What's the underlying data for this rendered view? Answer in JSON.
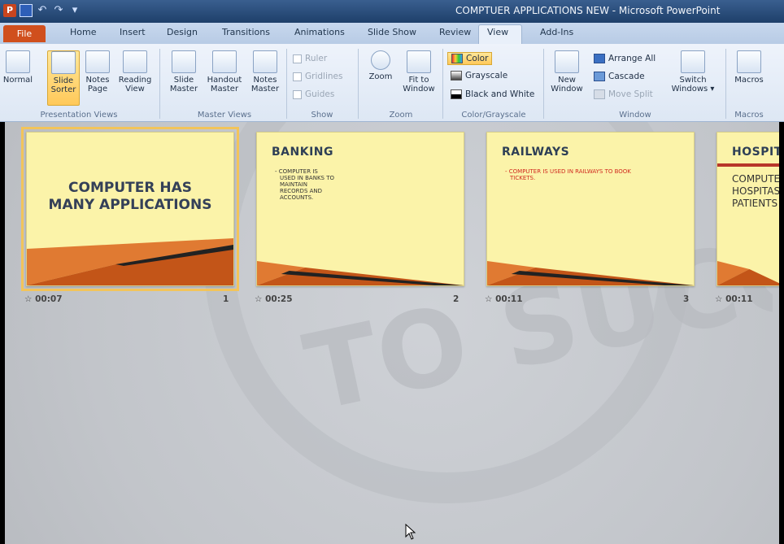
{
  "window": {
    "title": "COMPTUER APPLICATIONS NEW - Microsoft PowerPoint",
    "app_icon": "P"
  },
  "tabs": [
    "File",
    "Home",
    "Insert",
    "Design",
    "Transitions",
    "Animations",
    "Slide Show",
    "Review",
    "View",
    "Add-Ins"
  ],
  "active_tab": "View",
  "ribbon": {
    "presentation_views": {
      "normal": "Normal",
      "slide_sorter": [
        "Slide",
        "Sorter"
      ],
      "notes_page": [
        "Notes",
        "Page"
      ],
      "reading_view": [
        "Reading",
        "View"
      ],
      "label": "Presentation Views"
    },
    "master_views": {
      "slide_master": [
        "Slide",
        "Master"
      ],
      "handout_master": [
        "Handout",
        "Master"
      ],
      "notes_master": [
        "Notes",
        "Master"
      ],
      "label": "Master Views"
    },
    "show": {
      "ruler": "Ruler",
      "gridlines": "Gridlines",
      "guides": "Guides",
      "label": "Show"
    },
    "zoom": {
      "zoom": "Zoom",
      "fit_to_window": [
        "Fit to",
        "Window"
      ],
      "label": "Zoom"
    },
    "color_grayscale": {
      "color": "Color",
      "grayscale": "Grayscale",
      "black_white": "Black and White",
      "label": "Color/Grayscale"
    },
    "window": {
      "new_window": [
        "New",
        "Window"
      ],
      "arrange_all": "Arrange All",
      "cascade": "Cascade",
      "move_split": "Move Split",
      "switch_windows": [
        "Switch",
        "Windows ▾"
      ],
      "label": "Window"
    },
    "macros": {
      "macros": "Macros",
      "label": "Macros"
    }
  },
  "slides": [
    {
      "number": "1",
      "time": "00:07",
      "title": "",
      "center_text": [
        "COMPUTER HAS",
        "MANY APPLICATIONS"
      ],
      "bullets": []
    },
    {
      "number": "2",
      "time": "00:25",
      "title": "BANKING",
      "bullets": [
        "- COMPUTER IS",
        "USED IN BANKS TO",
        "MAINTAIN",
        "RECORDS AND",
        "ACCOUNTS."
      ]
    },
    {
      "number": "3",
      "time": "00:11",
      "title": "RAILWAYS",
      "bullets": [
        "- COMPUTER IS USED IN RAILWAYS TO BOOK",
        "TICKETS."
      ]
    },
    {
      "number": "",
      "time": "00:11",
      "title": "HOSPIT",
      "bullets": [
        "COMPUTE",
        "HOSPITAS",
        "PATIENTS"
      ]
    }
  ],
  "watermark_text": "TO SUCC"
}
